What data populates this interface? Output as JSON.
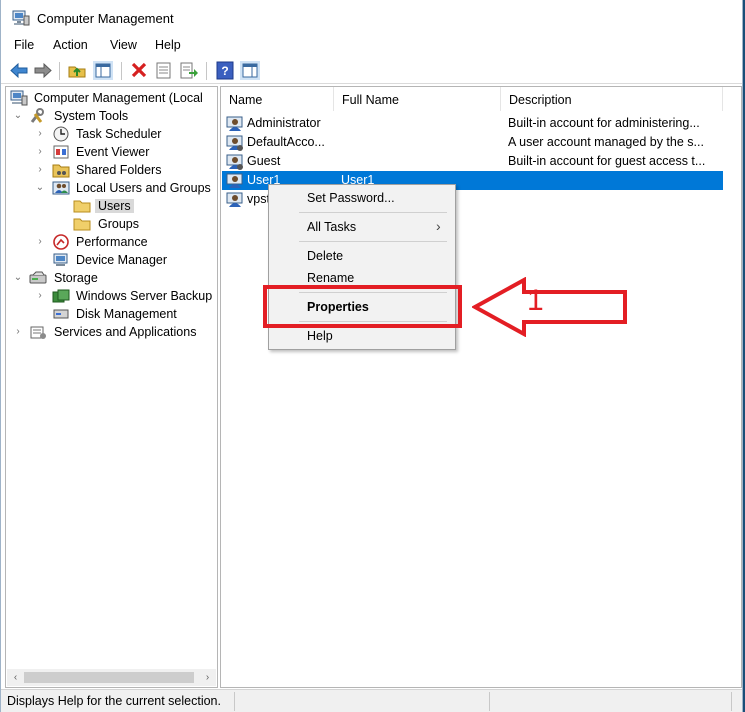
{
  "window": {
    "title": "Computer Management"
  },
  "menu": [
    "File",
    "Action",
    "View",
    "Help"
  ],
  "tree": [
    {
      "label": "Computer Management (Local",
      "icon": "computer-management-icon",
      "level": 0,
      "expander": ""
    },
    {
      "label": "System Tools",
      "icon": "system-tools-icon",
      "level": 1,
      "expander": "expanded"
    },
    {
      "label": "Task Scheduler",
      "icon": "clock-icon",
      "level": 2,
      "expander": "collapsed"
    },
    {
      "label": "Event Viewer",
      "icon": "event-viewer-icon",
      "level": 2,
      "expander": "collapsed"
    },
    {
      "label": "Shared Folders",
      "icon": "shared-folder-icon",
      "level": 2,
      "expander": "collapsed"
    },
    {
      "label": "Local Users and Groups",
      "icon": "users-groups-icon",
      "level": 2,
      "expander": "expanded"
    },
    {
      "label": "Users",
      "icon": "folder-icon",
      "level": 3,
      "expander": "",
      "selected": true
    },
    {
      "label": "Groups",
      "icon": "folder-icon",
      "level": 3,
      "expander": ""
    },
    {
      "label": "Performance",
      "icon": "performance-icon",
      "level": 2,
      "expander": "collapsed"
    },
    {
      "label": "Device Manager",
      "icon": "device-manager-icon",
      "level": 2,
      "expander": ""
    },
    {
      "label": "Storage",
      "icon": "storage-icon",
      "level": 1,
      "expander": "expanded"
    },
    {
      "label": "Windows Server Backup",
      "icon": "backup-icon",
      "level": 2,
      "expander": "collapsed"
    },
    {
      "label": "Disk Management",
      "icon": "disk-icon",
      "level": 2,
      "expander": ""
    },
    {
      "label": "Services and Applications",
      "icon": "services-icon",
      "level": 1,
      "expander": "collapsed"
    }
  ],
  "list": {
    "columns": [
      "Name",
      "Full Name",
      "Description"
    ],
    "rows": [
      {
        "name": "Administrator",
        "full_name": "",
        "description": "Built-in account for administering..."
      },
      {
        "name": "DefaultAcco...",
        "full_name": "",
        "description": "A user account managed by the s..."
      },
      {
        "name": "Guest",
        "full_name": "",
        "description": "Built-in account for guest access t..."
      },
      {
        "name": "User1",
        "full_name": "User1",
        "description": "",
        "selected": true
      },
      {
        "name": "vpst",
        "full_name": "",
        "description": ""
      }
    ]
  },
  "context_menu": {
    "set_password": "Set Password...",
    "all_tasks": "All Tasks",
    "delete": "Delete",
    "rename": "Rename",
    "properties": "Properties",
    "help": "Help"
  },
  "annotation": {
    "number": "1",
    "color": "#e31e24"
  },
  "status": {
    "text": "Displays Help for the current selection."
  },
  "colors": {
    "selection": "#0078d7",
    "annotation": "#e31e24"
  }
}
